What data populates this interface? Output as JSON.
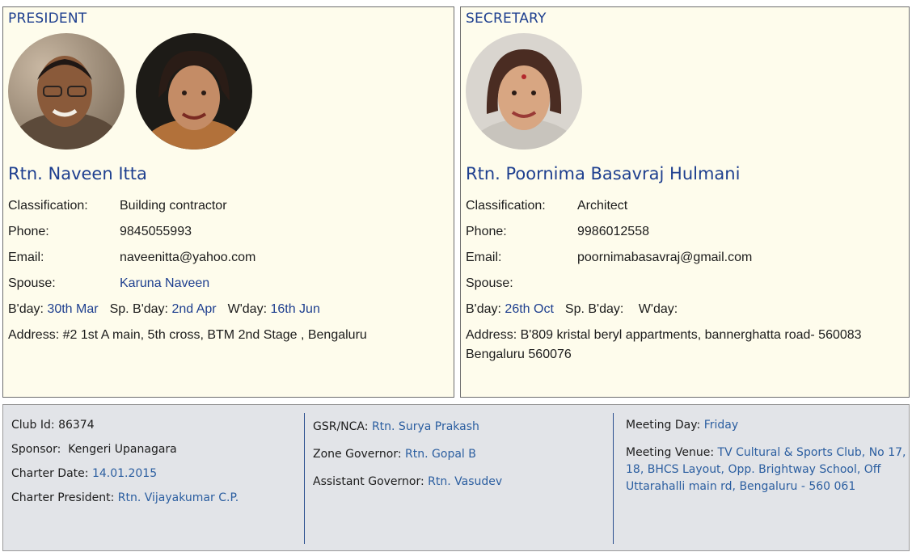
{
  "president": {
    "role": "PRESIDENT",
    "name": "Rtn. Naveen Itta",
    "rows": [
      {
        "label": "Classification:",
        "value": "Building contractor"
      },
      {
        "label": "Phone:",
        "value": "9845055993"
      },
      {
        "label": "Email:",
        "value": "naveenitta@yahoo.com"
      }
    ],
    "spouse_label": "Spouse:",
    "spouse": "Karuna Naveen",
    "bday_label": "B'day:",
    "bday": "30th Mar",
    "sp_bday_label": "Sp. B'day:",
    "sp_bday": "2nd Apr",
    "wday_label": "W'day:",
    "wday": "16th Jun",
    "address": "Address: #2 1st A main, 5th cross, BTM 2nd Stage , Bengaluru"
  },
  "secretary": {
    "role": "SECRETARY",
    "name": "Rtn. Poornima Basavraj Hulmani",
    "rows": [
      {
        "label": "Classification:",
        "value": "Architect"
      },
      {
        "label": "Phone:",
        "value": "9986012558"
      },
      {
        "label": "Email:",
        "value": "poornimabasavraj@gmail.com"
      }
    ],
    "spouse_label": "Spouse:",
    "spouse": "",
    "bday_label": "B'day:",
    "bday": "26th Oct",
    "sp_bday_label": "Sp. B'day:",
    "sp_bday": "",
    "wday_label": "W'day:",
    "wday": "",
    "address": "Address: B'809 kristal beryl appartments, bannerghatta road- 560083 Bengaluru 560076"
  },
  "club": {
    "club_id_label": "Club Id:",
    "club_id": "86374",
    "sponsor_label": "Sponsor:",
    "sponsor": "Kengeri Upanagara",
    "charter_date_label": "Charter Date:",
    "charter_date": "14.01.2015",
    "charter_president_label": "Charter President:",
    "charter_president": "Rtn. Vijayakumar C.P.",
    "gsr_label": "GSR/NCA:",
    "gsr": "Rtn. Surya Prakash",
    "zone_governor_label": "Zone Governor:",
    "zone_governor": "Rtn. Gopal B",
    "assistant_governor_label": "Assistant Governor:",
    "assistant_governor": "Rtn. Vasudev",
    "meeting_day_label": "Meeting Day:",
    "meeting_day": "Friday",
    "meeting_venue_label": "Meeting Venue:",
    "meeting_venue": "TV Cultural & Sports Club, No 17, 18, BHCS Layout, Opp. Brightway School, Off Uttarahalli main rd, Bengaluru - 560 061"
  },
  "colors": {
    "heading_blue": "#1e3f8f",
    "link_blue": "#2b5ea0",
    "panel_bg": "#fefcec",
    "footer_bg": "#e2e4e8"
  }
}
